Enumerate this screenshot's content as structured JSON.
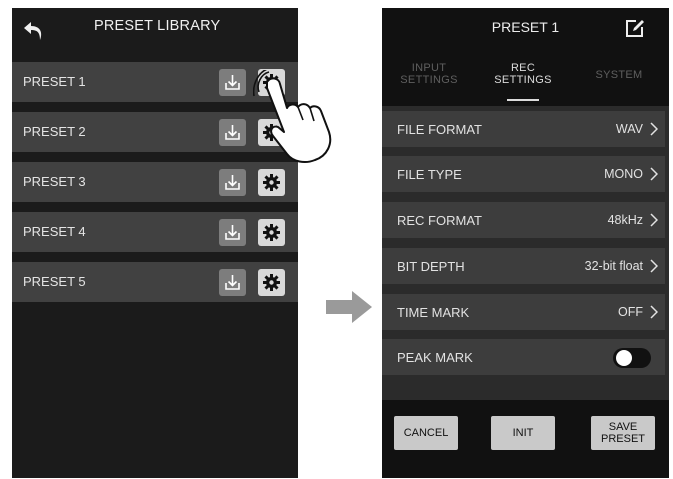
{
  "left": {
    "title": "PRESET LIBRARY",
    "back_icon": "back-arrow-icon",
    "presets": [
      {
        "label": "PRESET 1"
      },
      {
        "label": "PRESET 2"
      },
      {
        "label": "PRESET 3"
      },
      {
        "label": "PRESET 4"
      },
      {
        "label": "PRESET 5"
      }
    ],
    "row_icons": [
      "load-icon",
      "gear-icon"
    ],
    "pointer_icon": "tap-hand-icon"
  },
  "transition_icon": "right-arrow-icon",
  "right": {
    "title": "PRESET 1",
    "edit_icon": "edit-icon",
    "tabs": [
      {
        "line1": "INPUT",
        "line2": "SETTINGS",
        "active": false
      },
      {
        "line1": "REC",
        "line2": "SETTINGS",
        "active": true
      },
      {
        "line1": "SYSTEM",
        "line2": "",
        "active": false
      }
    ],
    "settings": [
      {
        "label": "FILE FORMAT",
        "value": "WAV"
      },
      {
        "label": "FILE TYPE",
        "value": "MONO"
      },
      {
        "label": "REC FORMAT",
        "value": "48kHz"
      },
      {
        "label": "BIT DEPTH",
        "value": "32-bit float"
      },
      {
        "label": "TIME MARK",
        "value": "OFF"
      },
      {
        "label": "PEAK MARK",
        "toggle": "off"
      }
    ],
    "buttons": {
      "cancel": "CANCEL",
      "init": "INIT",
      "save_line1": "SAVE",
      "save_line2": "PRESET"
    }
  },
  "colors": {
    "screen_bg": "#1b1b1b",
    "row_bg": "#414141",
    "button_light": "#c9c9c9",
    "arrow": "#9a9a9a"
  }
}
